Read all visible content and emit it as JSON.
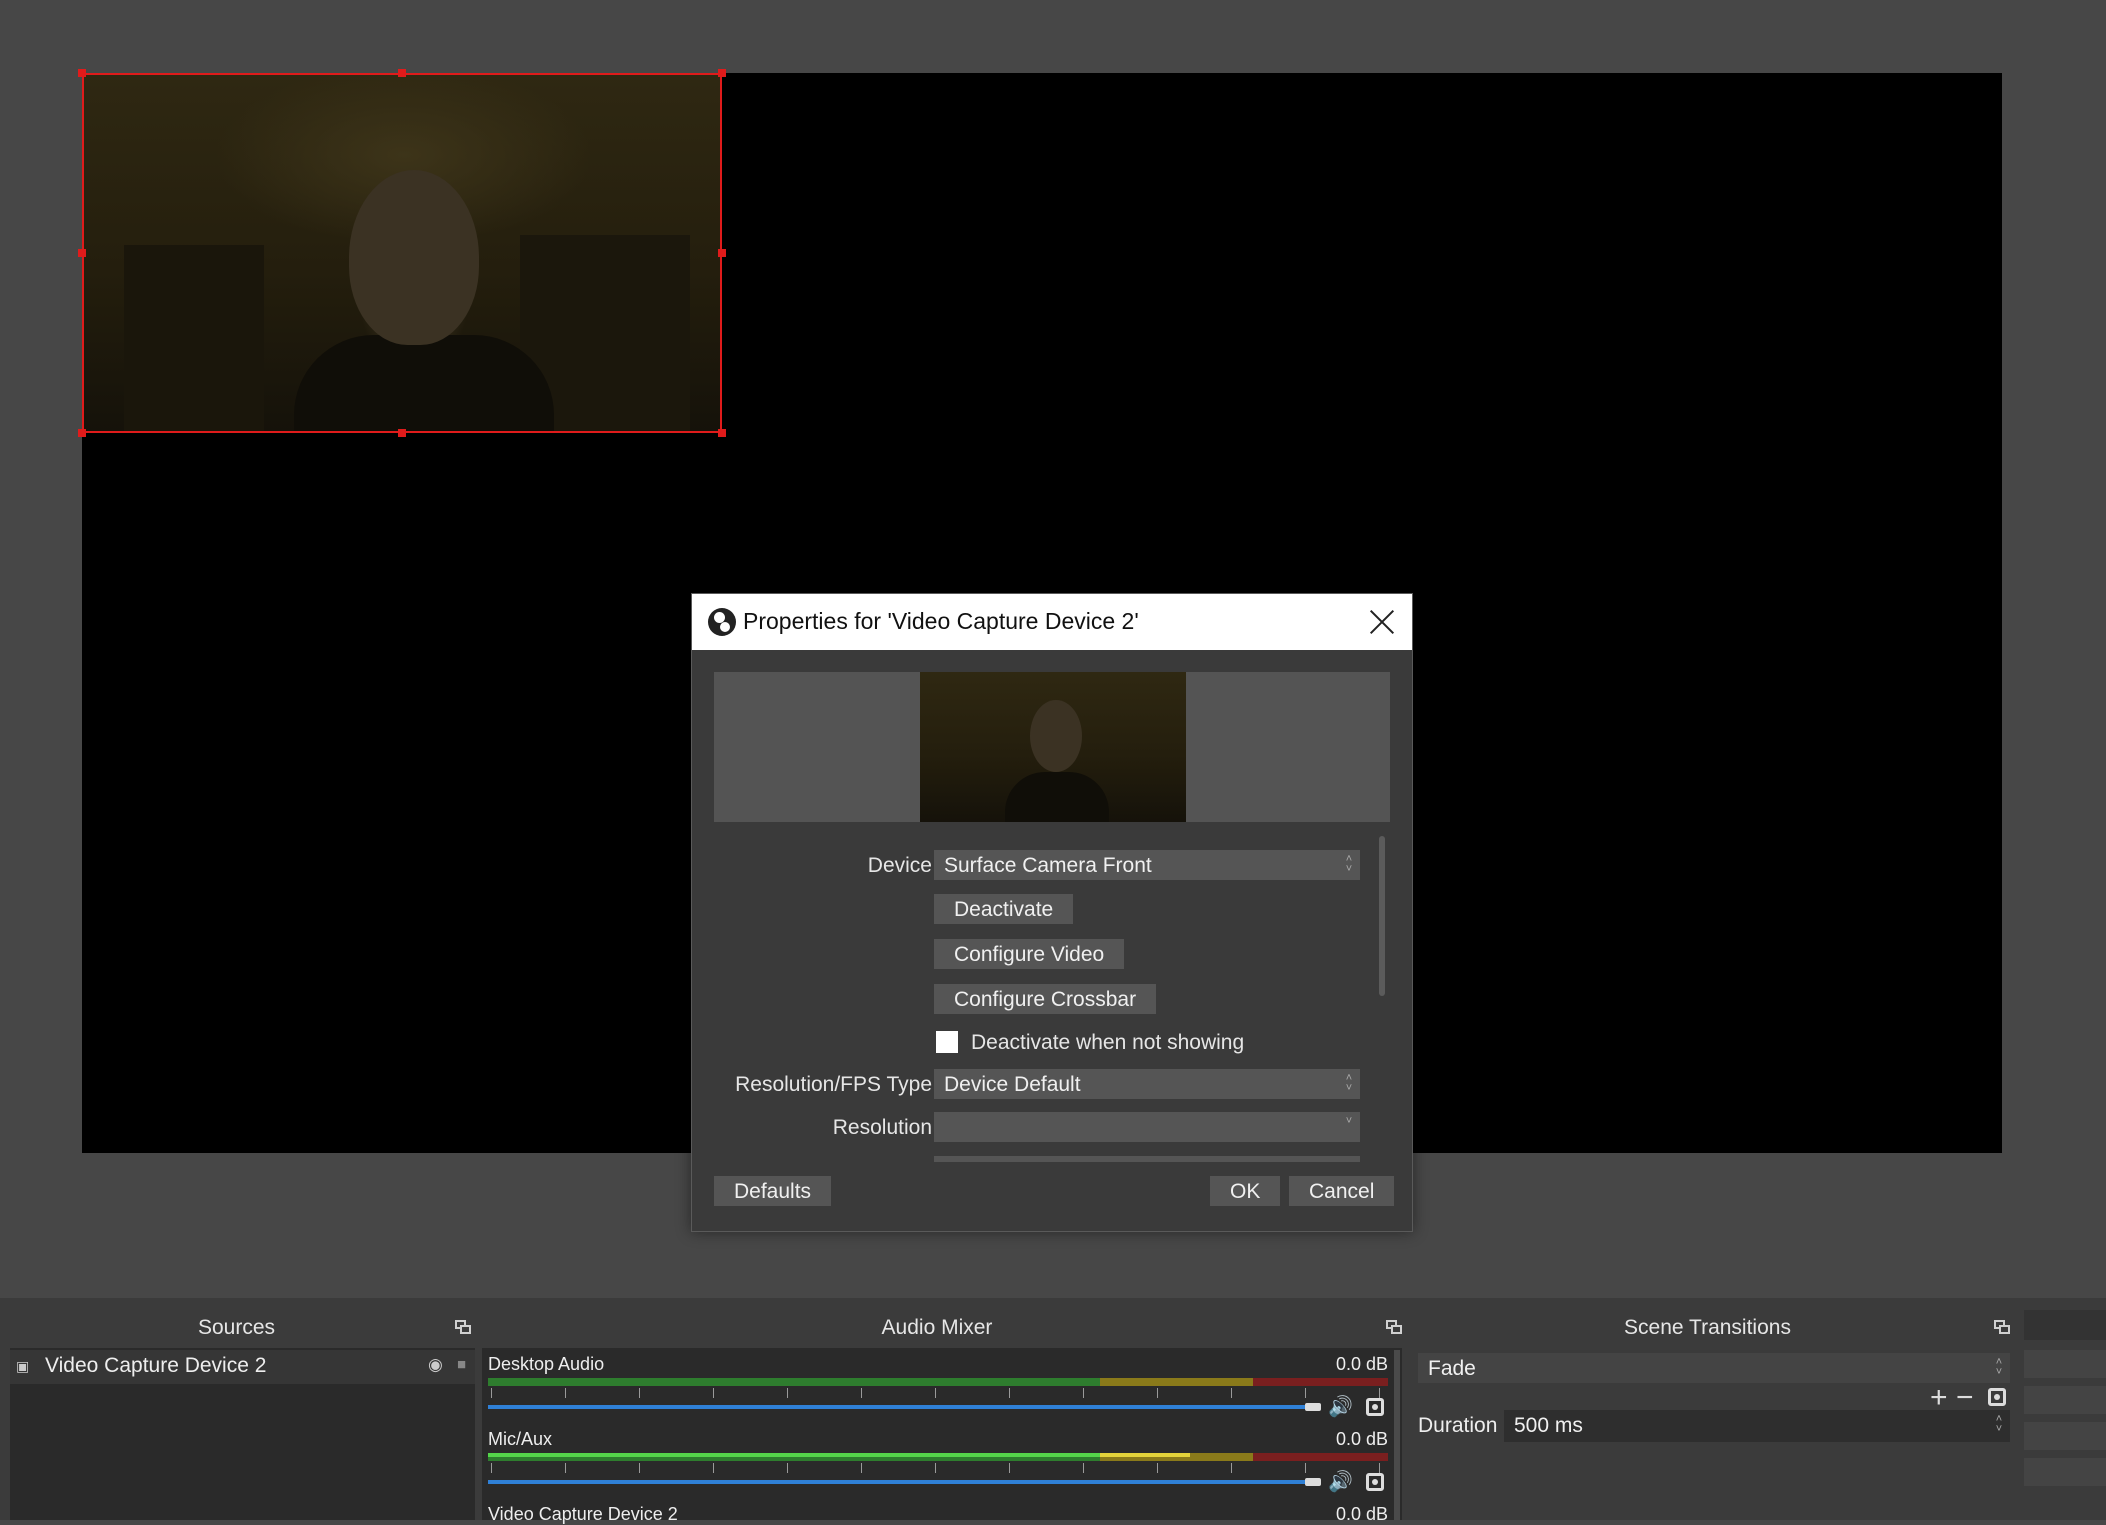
{
  "dialog": {
    "title": "Properties for 'Video Capture Device 2'",
    "device_label": "Device",
    "device_value": "Surface Camera Front",
    "deactivate_button": "Deactivate",
    "configure_video_button": "Configure Video",
    "configure_crossbar_button": "Configure Crossbar",
    "deactivate_when_not_showing": "Deactivate when not showing",
    "deactivate_when_not_showing_checked": false,
    "resolution_fps_type_label": "Resolution/FPS Type",
    "resolution_fps_type_value": "Device Default",
    "resolution_label": "Resolution",
    "resolution_value": "",
    "defaults_button": "Defaults",
    "ok_button": "OK",
    "cancel_button": "Cancel"
  },
  "sources": {
    "title": "Sources",
    "items": [
      {
        "label": "Video Capture Device 2",
        "visible": true,
        "locked": false
      }
    ]
  },
  "audio_mixer": {
    "title": "Audio Mixer",
    "channels": [
      {
        "name": "Desktop Audio",
        "level": "0.0 dB",
        "volume": 1.0
      },
      {
        "name": "Mic/Aux",
        "level": "0.0 dB",
        "volume": 1.0
      },
      {
        "name": "Video Capture Device 2",
        "level": "0.0 dB"
      }
    ]
  },
  "scene_transitions": {
    "title": "Scene Transitions",
    "transition": "Fade",
    "duration_label": "Duration",
    "duration_value": "500 ms"
  },
  "colors": {
    "selection_border": "#e01b1b",
    "volume_slider": "#2f80d6",
    "meter_green": "#54d54a",
    "meter_yellow": "#e3d33a",
    "meter_red": "#c23a3a"
  }
}
